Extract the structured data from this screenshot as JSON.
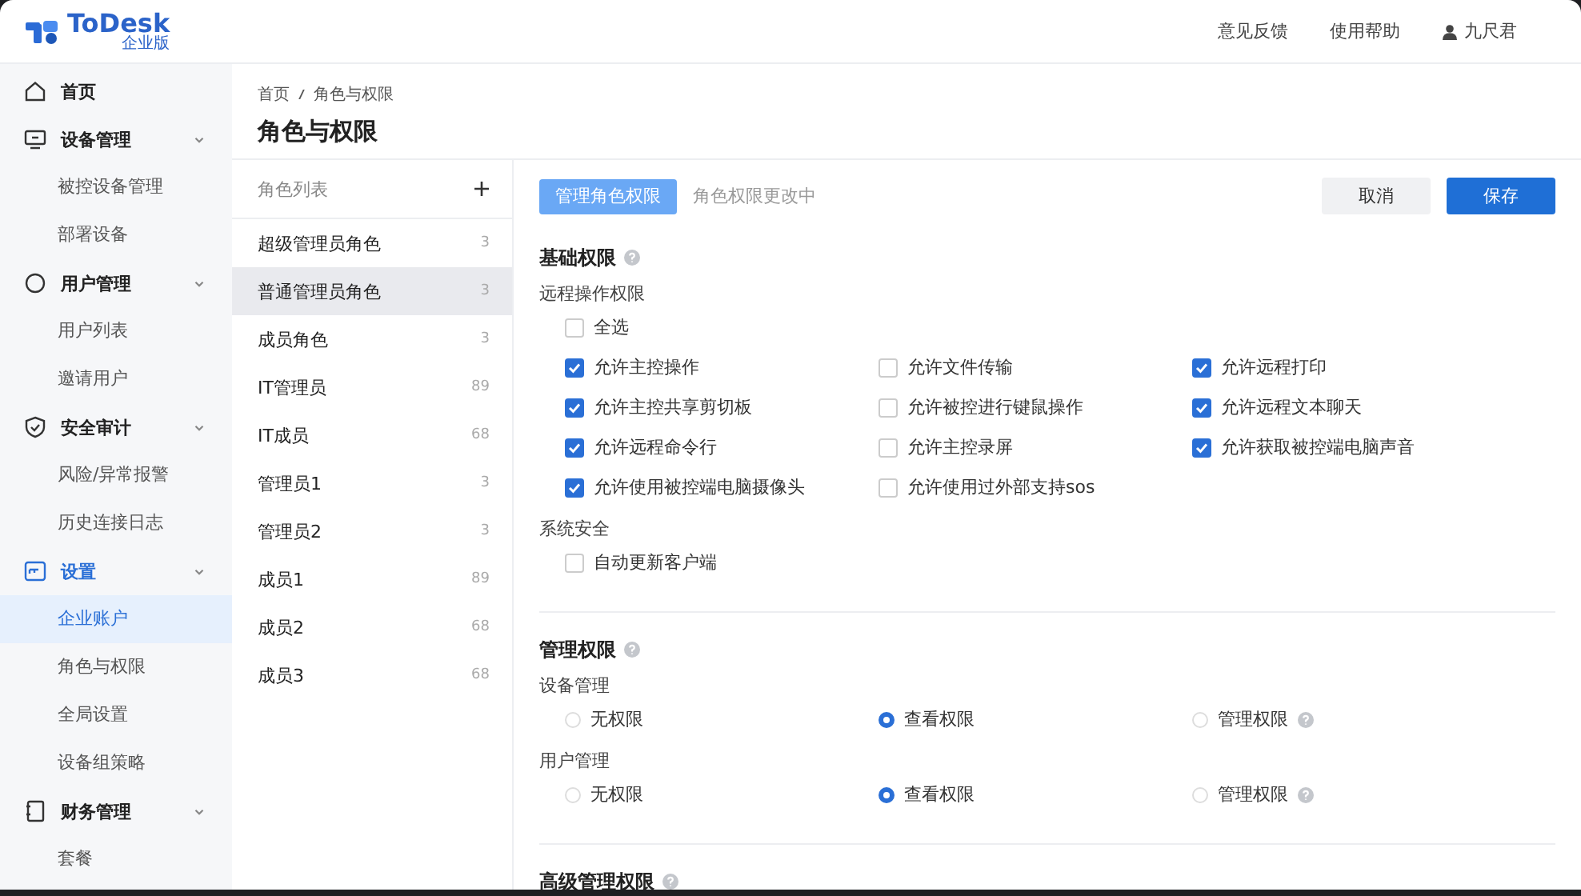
{
  "header": {
    "logo_text": "ToDesk",
    "logo_badge": "企业版",
    "links": [
      "意见反馈",
      "使用帮助"
    ],
    "user": "九尺君"
  },
  "sidebar": {
    "items": [
      {
        "label": "首页",
        "kind": "link",
        "active": false
      },
      {
        "label": "设备管理",
        "kind": "group",
        "active": false,
        "expanded": true,
        "children": [
          {
            "label": "被控设备管理",
            "selected": false
          },
          {
            "label": "部署设备",
            "selected": false
          }
        ]
      },
      {
        "label": "用户管理",
        "kind": "group",
        "active": false,
        "expanded": true,
        "children": [
          {
            "label": "用户列表",
            "selected": false
          },
          {
            "label": "邀请用户",
            "selected": false
          }
        ]
      },
      {
        "label": "安全审计",
        "kind": "group",
        "active": false,
        "expanded": true,
        "children": [
          {
            "label": "风险/异常报警",
            "selected": false
          },
          {
            "label": "历史连接日志",
            "selected": false
          }
        ]
      },
      {
        "label": "设置",
        "kind": "group",
        "active": true,
        "expanded": true,
        "children": [
          {
            "label": "企业账户",
            "selected": true
          },
          {
            "label": "角色与权限",
            "selected": false
          },
          {
            "label": "全局设置",
            "selected": false
          },
          {
            "label": "设备组策略",
            "selected": false
          }
        ]
      },
      {
        "label": "财务管理",
        "kind": "group",
        "active": false,
        "expanded": true,
        "children": [
          {
            "label": "套餐",
            "selected": false
          }
        ]
      }
    ]
  },
  "breadcrumb": [
    "首页",
    "角色与权限"
  ],
  "page_title": "角色与权限",
  "roles": {
    "title": "角色列表",
    "items": [
      {
        "name": "超级管理员角色",
        "count": "3",
        "selected": false
      },
      {
        "name": "普通管理员角色",
        "count": "3",
        "selected": true
      },
      {
        "name": "成员角色",
        "count": "3",
        "selected": false
      },
      {
        "name": "IT管理员",
        "count": "89",
        "selected": false
      },
      {
        "name": "IT成员",
        "count": "68",
        "selected": false
      },
      {
        "name": "管理员1",
        "count": "3",
        "selected": false
      },
      {
        "name": "管理员2",
        "count": "3",
        "selected": false
      },
      {
        "name": "成员1",
        "count": "89",
        "selected": false
      },
      {
        "name": "成员2",
        "count": "68",
        "selected": false
      },
      {
        "name": "成员3",
        "count": "68",
        "selected": false
      }
    ]
  },
  "toolbar": {
    "tab": "管理角色权限",
    "status": "角色权限更改中",
    "cancel": "取消",
    "save": "保存"
  },
  "sections": [
    {
      "title": "基础权限",
      "help": true,
      "groups": [
        {
          "label": "远程操作权限",
          "kind": "checkboxes",
          "select_all": {
            "label": "全选",
            "checked": false
          },
          "options": [
            {
              "label": "允许主控操作",
              "checked": true
            },
            {
              "label": "允许文件传输",
              "checked": false
            },
            {
              "label": "允许远程打印",
              "checked": true
            },
            {
              "label": "允许主控共享剪切板",
              "checked": true
            },
            {
              "label": "允许被控进行键鼠操作",
              "checked": false
            },
            {
              "label": "允许远程文本聊天",
              "checked": true
            },
            {
              "label": "允许远程命令行",
              "checked": true
            },
            {
              "label": "允许主控录屏",
              "checked": false
            },
            {
              "label": "允许获取被控端电脑声音",
              "checked": true
            },
            {
              "label": "允许使用被控端电脑摄像头",
              "checked": true
            },
            {
              "label": "允许使用过外部支持sos",
              "checked": false
            }
          ]
        },
        {
          "label": "系统安全",
          "kind": "checkboxes",
          "options": [
            {
              "label": "自动更新客户端",
              "checked": false
            }
          ]
        }
      ]
    },
    {
      "title": "管理权限",
      "help": true,
      "groups": [
        {
          "label": "设备管理",
          "kind": "radios",
          "options": [
            {
              "label": "无权限",
              "selected": false,
              "help": false
            },
            {
              "label": "查看权限",
              "selected": true,
              "help": false
            },
            {
              "label": "管理权限",
              "selected": false,
              "help": true
            }
          ]
        },
        {
          "label": "用户管理",
          "kind": "radios",
          "options": [
            {
              "label": "无权限",
              "selected": false,
              "help": false
            },
            {
              "label": "查看权限",
              "selected": true,
              "help": false
            },
            {
              "label": "管理权限",
              "selected": false,
              "help": true
            }
          ]
        }
      ]
    },
    {
      "title": "高级管理权限",
      "help": true
    }
  ]
}
